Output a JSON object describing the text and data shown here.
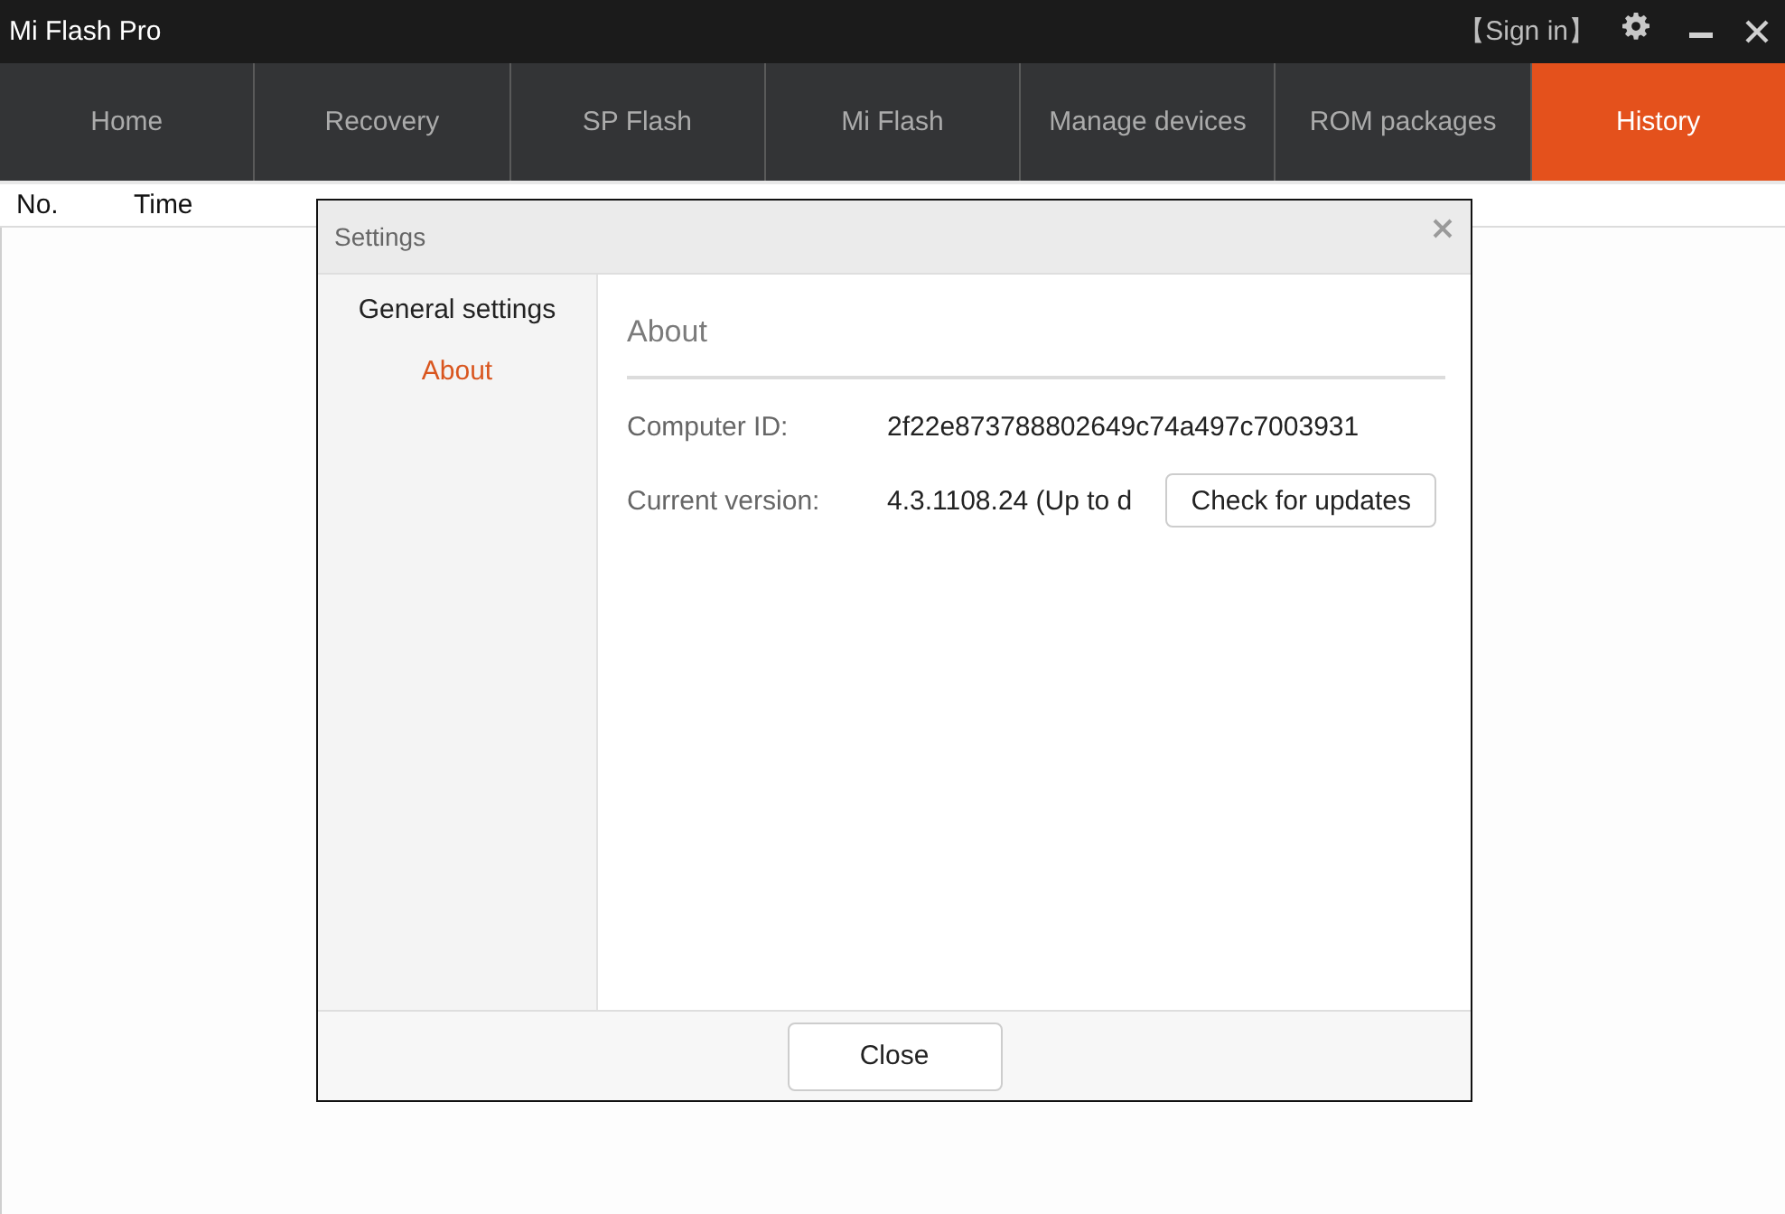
{
  "window": {
    "title": "Mi Flash Pro",
    "sign_in": "【Sign in】"
  },
  "tabs": [
    {
      "label": "Home",
      "selected": false
    },
    {
      "label": "Recovery",
      "selected": false
    },
    {
      "label": "SP Flash",
      "selected": false
    },
    {
      "label": "Mi Flash",
      "selected": false
    },
    {
      "label": "Manage devices",
      "selected": false
    },
    {
      "label": "ROM packages",
      "selected": false
    },
    {
      "label": "History",
      "selected": true
    }
  ],
  "table": {
    "columns": [
      "No.",
      "Time"
    ]
  },
  "dialog": {
    "title": "Settings",
    "sidebar": [
      {
        "label": "General settings",
        "selected": false
      },
      {
        "label": "About",
        "selected": true
      }
    ],
    "section_title": "About",
    "fields": [
      {
        "label": "Computer ID:",
        "value": "2f22e873788802649c74a497c7003931"
      },
      {
        "label": "Current version:",
        "value": "4.3.1108.24 (Up to d",
        "button": "Check for updates"
      }
    ],
    "close_button": "Close"
  }
}
